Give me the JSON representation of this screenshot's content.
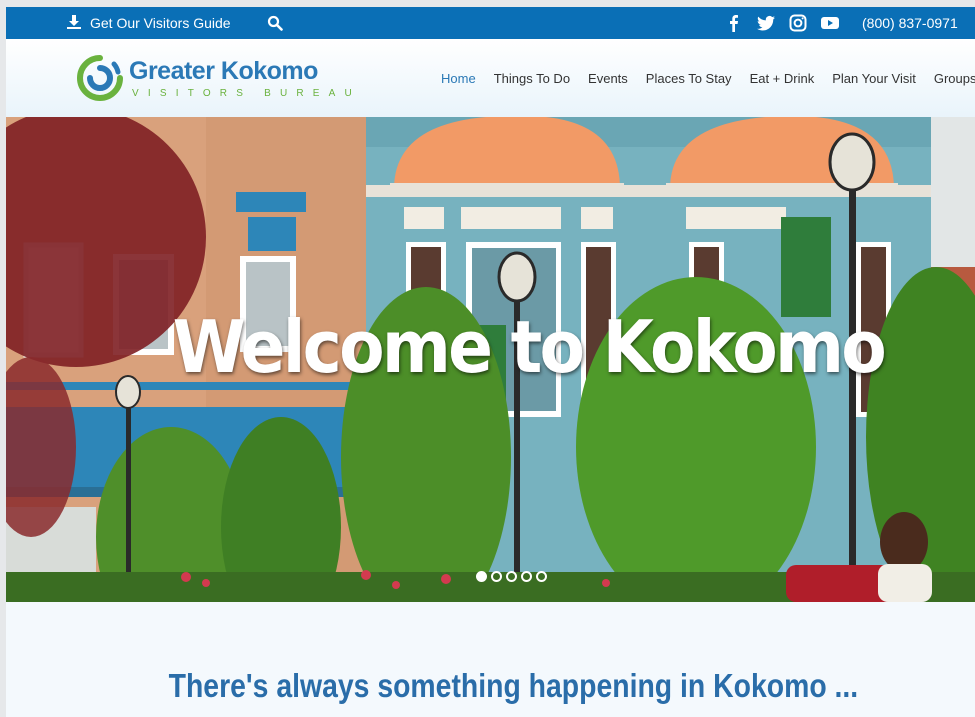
{
  "topbar": {
    "guide_label": "Get Our Visitors Guide",
    "phone": "(800) 837-0971",
    "icons": [
      "download-icon",
      "search-icon",
      "facebook-icon",
      "twitter-icon",
      "instagram-icon",
      "youtube-icon"
    ],
    "background": "#0a6fb6"
  },
  "logo": {
    "name": "Greater Kokomo",
    "subtitle": "VISITORS BUREAU",
    "colors": {
      "blue": "#2b79b6",
      "green": "#6ab23e"
    }
  },
  "nav": {
    "items": [
      {
        "label": "Home",
        "active": true
      },
      {
        "label": "Things To Do"
      },
      {
        "label": "Events"
      },
      {
        "label": "Places To Stay"
      },
      {
        "label": "Eat + Drink"
      },
      {
        "label": "Plan Your Visit"
      },
      {
        "label": "Groups"
      }
    ]
  },
  "hero": {
    "title": "Welcome to Kokomo",
    "slides": 5,
    "active_slide": 1
  },
  "tagline": "There's always something happening in Kokomo ..."
}
